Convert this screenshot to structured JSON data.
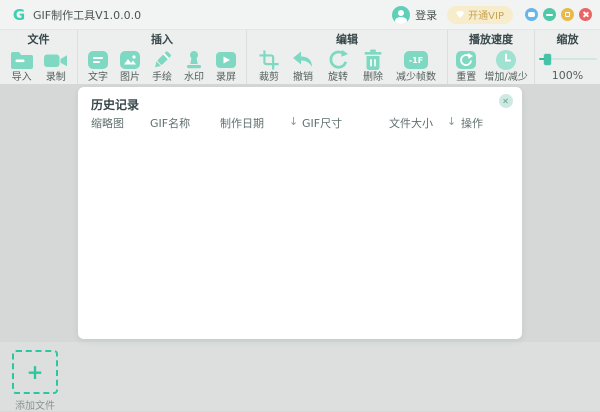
{
  "titlebar": {
    "logo": "G",
    "app_title": "GIF制作工具V1.0.0.0",
    "login_label": "登录",
    "vip_label": "开通VIP"
  },
  "toolbar": {
    "groups": [
      {
        "title": "文件",
        "items": [
          {
            "label": "导入"
          },
          {
            "label": "录制"
          }
        ]
      },
      {
        "title": "插入",
        "items": [
          {
            "label": "文字"
          },
          {
            "label": "图片"
          },
          {
            "label": "手绘"
          },
          {
            "label": "水印"
          },
          {
            "label": "录屏"
          }
        ]
      },
      {
        "title": "编辑",
        "items": [
          {
            "label": "裁剪"
          },
          {
            "label": "撤销"
          },
          {
            "label": "旋转"
          },
          {
            "label": "删除"
          },
          {
            "label": "减少帧数",
            "badge": "-1F"
          }
        ]
      },
      {
        "title": "播放速度",
        "items": [
          {
            "label": "重置"
          },
          {
            "label": "增加/减少"
          }
        ]
      },
      {
        "title": "缩放",
        "zoom_value": "100%"
      }
    ]
  },
  "history_panel": {
    "title": "历史记录",
    "sort_arrow": "↓",
    "columns": [
      "缩略图",
      "GIF名称",
      "制作日期",
      "GIF尺寸",
      "文件大小",
      "操作"
    ]
  },
  "add_file": {
    "plus": "+",
    "label": "添加文件"
  },
  "colors": {
    "accent": "#7fd9c2",
    "accent_dark": "#2dc79f",
    "vip_bg": "#f7edcc",
    "vip_text": "#c9a254"
  }
}
